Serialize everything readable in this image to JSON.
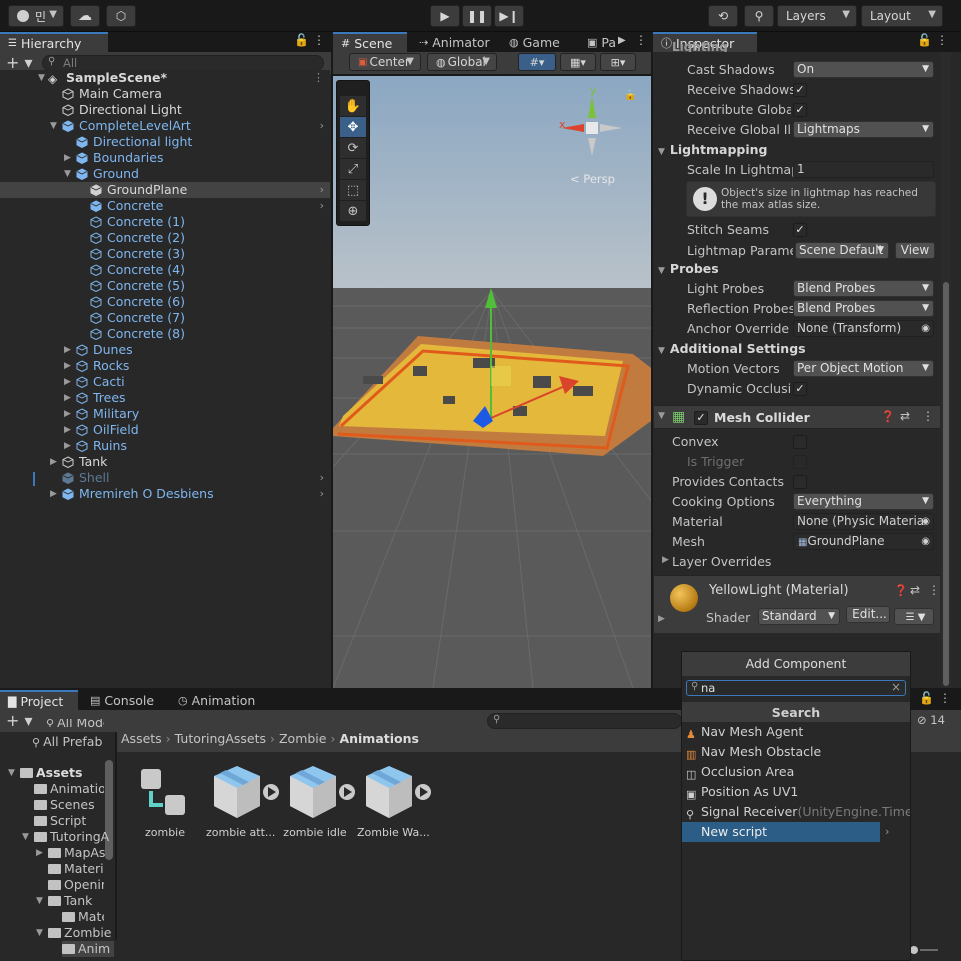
{
  "toolbar": {
    "account_initial": "민",
    "layers_label": "Layers",
    "layout_label": "Layout"
  },
  "hierarchy": {
    "tab_label": "Hierarchy",
    "search_placeholder": "All",
    "scene_name": "SampleScene*",
    "rows": [
      {
        "label": "Main Camera"
      },
      {
        "label": "Directional Light"
      },
      {
        "label": "CompleteLevelArt"
      },
      {
        "label": "Directional light"
      },
      {
        "label": "Boundaries"
      },
      {
        "label": "Ground"
      },
      {
        "label": "GroundPlane"
      },
      {
        "label": "Concrete"
      },
      {
        "label": "Concrete (1)"
      },
      {
        "label": "Concrete (2)"
      },
      {
        "label": "Concrete (3)"
      },
      {
        "label": "Concrete (4)"
      },
      {
        "label": "Concrete (5)"
      },
      {
        "label": "Concrete (6)"
      },
      {
        "label": "Concrete (7)"
      },
      {
        "label": "Concrete (8)"
      },
      {
        "label": "Dunes"
      },
      {
        "label": "Rocks"
      },
      {
        "label": "Cacti"
      },
      {
        "label": "Trees"
      },
      {
        "label": "Military"
      },
      {
        "label": "OilField"
      },
      {
        "label": "Ruins"
      },
      {
        "label": "Tank"
      },
      {
        "label": "Shell"
      },
      {
        "label": "Mremireh O Desbiens"
      }
    ]
  },
  "scene": {
    "tabs": [
      "Scene",
      "Animator",
      "Game",
      "Pa"
    ],
    "pivot_label": "Center",
    "space_label": "Global",
    "gizmo_y": "y",
    "gizmo_x": "x",
    "persp_label": "< Persp"
  },
  "inspector": {
    "tab_label": "Inspector",
    "partial_header": "Lighting",
    "cast_shadows_label": "Cast Shadows",
    "cast_shadows_value": "On",
    "receive_shadows_label": "Receive Shadows",
    "contribute_gi_label": "Contribute Global I",
    "receive_gi_label": "Receive Global Illu",
    "receive_gi_value": "Lightmaps",
    "lightmapping_header": "Lightmapping",
    "scale_lightmap_label": "Scale In Lightmap",
    "scale_lightmap_value": "1",
    "warning_text": "Object's size in lightmap has reached the max atlas size.",
    "stitch_seams_label": "Stitch Seams",
    "lightmap_params_label": "Lightmap Paramete",
    "lightmap_params_value": "Scene Default",
    "view_button": "View",
    "probes_header": "Probes",
    "light_probes_label": "Light Probes",
    "light_probes_value": "Blend Probes",
    "reflection_probes_label": "Reflection Probes",
    "reflection_probes_value": "Blend Probes",
    "anchor_override_label": "Anchor Override",
    "anchor_override_value": "None (Transform)",
    "additional_header": "Additional Settings",
    "motion_vectors_label": "Motion Vectors",
    "motion_vectors_value": "Per Object Motion",
    "dynamic_occlusion_label": "Dynamic Occlusion",
    "mesh_collider_title": "Mesh Collider",
    "convex_label": "Convex",
    "is_trigger_label": "Is Trigger",
    "provides_contacts_label": "Provides Contacts",
    "cooking_options_label": "Cooking Options",
    "cooking_options_value": "Everything",
    "material_label": "Material",
    "material_value": "None (Physic Materia",
    "mesh_label": "Mesh",
    "mesh_value": "GroundPlane",
    "layer_overrides_label": "Layer Overrides",
    "material_title": "YellowLight (Material)",
    "shader_label": "Shader",
    "shader_value": "Standard",
    "edit_button": "Edit..."
  },
  "project": {
    "tabs": [
      "Project",
      "Console",
      "Animation"
    ],
    "tree": [
      {
        "label": "All Models"
      },
      {
        "label": "All Prefab"
      },
      {
        "label": "Assets"
      },
      {
        "label": "Animation"
      },
      {
        "label": "Scenes"
      },
      {
        "label": "Script"
      },
      {
        "label": "TutoringA"
      },
      {
        "label": "MapAs"
      },
      {
        "label": "Materi"
      },
      {
        "label": "Openin"
      },
      {
        "label": "Tank"
      },
      {
        "label": "Mate"
      },
      {
        "label": "Zombie"
      },
      {
        "label": "Anim"
      }
    ],
    "breadcrumb": [
      "Assets",
      "TutoringAssets",
      "Zombie",
      "Animations"
    ],
    "assets": [
      {
        "label": "zombie"
      },
      {
        "label": "zombie att..."
      },
      {
        "label": "zombie idle"
      },
      {
        "label": "Zombie Wa..."
      }
    ],
    "hidden_count": "14"
  },
  "add_component": {
    "title": "Add Component",
    "search_value": "na",
    "section_label": "Search",
    "items": [
      {
        "label": "Nav Mesh Agent",
        "suffix": ""
      },
      {
        "label": "Nav Mesh Obstacle",
        "suffix": ""
      },
      {
        "label": "Occlusion Area",
        "suffix": ""
      },
      {
        "label": "Position As UV1",
        "suffix": ""
      },
      {
        "label": "Signal Receiver",
        "suffix": "(UnityEngine.Timeline"
      },
      {
        "label": "New script",
        "suffix": ""
      }
    ]
  },
  "colors": {
    "accent": "#3a79bb",
    "selection": "#2c5d87",
    "prefab_blue": "#7fb6ef"
  }
}
